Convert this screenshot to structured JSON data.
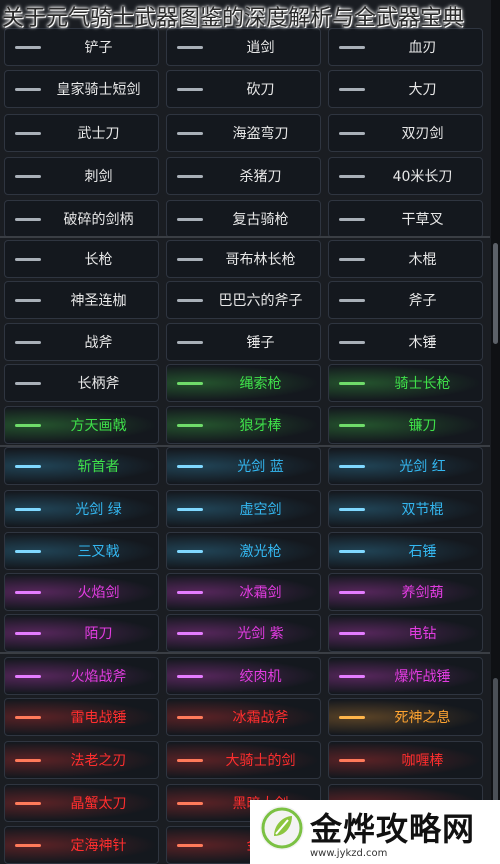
{
  "page": {
    "title": "关于元气骑士武器图鉴的深度解析与全武器宝典"
  },
  "colors": {
    "white": "#e8e8e8",
    "green": "#3fe04a",
    "blue": "#34b7f0",
    "purple": "#e13ce0",
    "red": "#ff2e2e",
    "orange": "#ffa431"
  },
  "rows": [
    {
      "cells": [
        {
          "label": "铲子",
          "color": "white",
          "icon": "shovel-icon",
          "glow": "none"
        },
        {
          "label": "逍剑",
          "color": "white",
          "icon": "sword-icon",
          "glow": "none"
        },
        {
          "label": "血刃",
          "color": "white",
          "icon": "blade-icon",
          "glow": "none"
        }
      ]
    },
    {
      "cells": [
        {
          "label": "皇家骑士短剑",
          "color": "white",
          "icon": "short-sword-icon",
          "glow": "none"
        },
        {
          "label": "砍刀",
          "color": "white",
          "icon": "machete-icon",
          "glow": "none"
        },
        {
          "label": "大刀",
          "color": "white",
          "icon": "broadsword-icon",
          "glow": "none"
        }
      ]
    },
    {
      "cells": [
        {
          "label": "武士刀",
          "color": "white",
          "icon": "katana-icon",
          "glow": "none"
        },
        {
          "label": "海盗弯刀",
          "color": "white",
          "icon": "cutlass-icon",
          "glow": "none"
        },
        {
          "label": "双刃剑",
          "color": "white",
          "icon": "double-blade-icon",
          "glow": "none"
        }
      ]
    },
    {
      "cells": [
        {
          "label": "刺剑",
          "color": "white",
          "icon": "rapier-icon",
          "glow": "none"
        },
        {
          "label": "杀猪刀",
          "color": "white",
          "icon": "butcher-knife-icon",
          "glow": "none"
        },
        {
          "label": "40米长刀",
          "color": "white",
          "icon": "long-blade-icon",
          "glow": "none"
        }
      ]
    },
    {
      "cells": [
        {
          "label": "破碎的剑柄",
          "color": "white",
          "icon": "broken-hilt-icon",
          "glow": "none"
        },
        {
          "label": "复古骑枪",
          "color": "white",
          "icon": "lance-icon",
          "glow": "none"
        },
        {
          "label": "干草叉",
          "color": "white",
          "icon": "pitchfork-icon",
          "glow": "none"
        }
      ]
    },
    {
      "cells": [
        {
          "label": "长枪",
          "color": "white",
          "icon": "spear-icon",
          "glow": "none"
        },
        {
          "label": "哥布林长枪",
          "color": "white",
          "icon": "goblin-spear-icon",
          "glow": "none"
        },
        {
          "label": "木棍",
          "color": "white",
          "icon": "stick-icon",
          "glow": "none"
        }
      ]
    },
    {
      "cells": [
        {
          "label": "神圣连枷",
          "color": "white",
          "icon": "flail-icon",
          "glow": "none"
        },
        {
          "label": "巴巴六的斧子",
          "color": "white",
          "icon": "axe-icon",
          "glow": "none"
        },
        {
          "label": "斧子",
          "color": "white",
          "icon": "axe-icon",
          "glow": "none"
        }
      ]
    },
    {
      "cells": [
        {
          "label": "战斧",
          "color": "white",
          "icon": "battle-axe-icon",
          "glow": "none"
        },
        {
          "label": "锤子",
          "color": "white",
          "icon": "hammer-icon",
          "glow": "none"
        },
        {
          "label": "木锤",
          "color": "white",
          "icon": "mallet-icon",
          "glow": "none"
        }
      ]
    },
    {
      "cells": [
        {
          "label": "长柄斧",
          "color": "white",
          "icon": "halberd-icon",
          "glow": "none"
        },
        {
          "label": "绳索枪",
          "color": "green",
          "icon": "rope-spear-icon",
          "glow": "green"
        },
        {
          "label": "骑士长枪",
          "color": "green",
          "icon": "knight-lance-icon",
          "glow": "green"
        }
      ]
    },
    {
      "cells": [
        {
          "label": "方天画戟",
          "color": "green",
          "icon": "halberd-icon",
          "glow": "green"
        },
        {
          "label": "狼牙棒",
          "color": "green",
          "icon": "mace-icon",
          "glow": "green"
        },
        {
          "label": "镰刀",
          "color": "green",
          "icon": "scythe-icon",
          "glow": "green"
        }
      ]
    },
    {
      "cells": [
        {
          "label": "斩首者",
          "color": "green",
          "icon": "executioner-icon",
          "glow": "blue"
        },
        {
          "label": "光剑 蓝",
          "color": "blue",
          "icon": "lightsaber-icon",
          "glow": "blue"
        },
        {
          "label": "光剑 红",
          "color": "blue",
          "icon": "lightsaber-icon",
          "glow": "blue"
        }
      ]
    },
    {
      "cells": [
        {
          "label": "光剑 绿",
          "color": "blue",
          "icon": "lightsaber-icon",
          "glow": "blue"
        },
        {
          "label": "虚空剑",
          "color": "blue",
          "icon": "void-sword-icon",
          "glow": "blue"
        },
        {
          "label": "双节棍",
          "color": "blue",
          "icon": "nunchaku-icon",
          "glow": "blue"
        }
      ]
    },
    {
      "cells": [
        {
          "label": "三叉戟",
          "color": "blue",
          "icon": "trident-icon",
          "glow": "blue"
        },
        {
          "label": "激光枪",
          "color": "blue",
          "icon": "laser-spear-icon",
          "glow": "blue"
        },
        {
          "label": "石锤",
          "color": "blue",
          "icon": "stone-hammer-icon",
          "glow": "blue"
        }
      ]
    },
    {
      "cells": [
        {
          "label": "火焰剑",
          "color": "purple",
          "icon": "flame-sword-icon",
          "glow": "purple"
        },
        {
          "label": "冰霜剑",
          "color": "purple",
          "icon": "frost-sword-icon",
          "glow": "purple"
        },
        {
          "label": "养剑葫",
          "color": "purple",
          "icon": "gourd-icon",
          "glow": "purple"
        }
      ]
    },
    {
      "cells": [
        {
          "label": "陌刀",
          "color": "purple",
          "icon": "mo-blade-icon",
          "glow": "purple"
        },
        {
          "label": "光剑 紫",
          "color": "purple",
          "icon": "lightsaber-icon",
          "glow": "purple"
        },
        {
          "label": "电钻",
          "color": "purple",
          "icon": "drill-icon",
          "glow": "purple"
        }
      ]
    },
    {
      "cells": [
        {
          "label": "火焰战斧",
          "color": "purple",
          "icon": "flame-axe-icon",
          "glow": "purple"
        },
        {
          "label": "绞肉机",
          "color": "purple",
          "icon": "grinder-icon",
          "glow": "purple"
        },
        {
          "label": "爆炸战锤",
          "color": "purple",
          "icon": "explosive-hammer-icon",
          "glow": "purple"
        }
      ]
    },
    {
      "cells": [
        {
          "label": "雷电战锤",
          "color": "red",
          "icon": "thunder-hammer-icon",
          "glow": "red"
        },
        {
          "label": "冰霜战斧",
          "color": "red",
          "icon": "frost-axe-icon",
          "glow": "red"
        },
        {
          "label": "死神之息",
          "color": "orange",
          "icon": "death-breath-icon",
          "glow": "orange"
        }
      ]
    },
    {
      "cells": [
        {
          "label": "法老之刃",
          "color": "red",
          "icon": "pharaoh-blade-icon",
          "glow": "red"
        },
        {
          "label": "大骑士的剑",
          "color": "red",
          "icon": "grand-knight-sword-icon",
          "glow": "red"
        },
        {
          "label": "咖喱棒",
          "color": "red",
          "icon": "curry-stick-icon",
          "glow": "red"
        }
      ]
    },
    {
      "cells": [
        {
          "label": "晶蟹太刀",
          "color": "red",
          "icon": "crab-katana-icon",
          "glow": "red"
        },
        {
          "label": "黑暗大剑",
          "color": "red",
          "icon": "dark-greatsword-icon",
          "glow": "red"
        },
        {
          "label": "",
          "color": "red",
          "icon": "",
          "glow": "red"
        }
      ]
    },
    {
      "cells": [
        {
          "label": "定海神针",
          "color": "red",
          "icon": "staff-icon",
          "glow": "red"
        },
        {
          "label": "金箍",
          "color": "red",
          "icon": "staff-icon",
          "glow": "red"
        },
        {
          "label": "",
          "color": "red",
          "icon": "",
          "glow": "red"
        }
      ]
    }
  ],
  "watermark": {
    "text": "金烨攻略网",
    "url": "www.jykzd.com"
  }
}
